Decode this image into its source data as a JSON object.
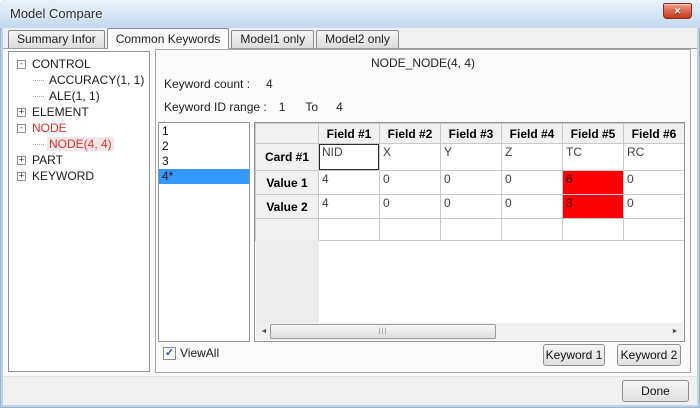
{
  "window": {
    "title": "Model Compare",
    "close_glyph": "✕"
  },
  "tabs": [
    {
      "label": "Summary Infor",
      "active": false
    },
    {
      "label": "Common Keywords",
      "active": true
    },
    {
      "label": "Model1 only",
      "active": false
    },
    {
      "label": "Model2 only",
      "active": false
    }
  ],
  "tree": {
    "items": [
      {
        "label": "CONTROL",
        "level": 0,
        "expander": "minus",
        "red": false,
        "selected": false
      },
      {
        "label": "ACCURACY(1, 1)",
        "level": 1,
        "expander": "none",
        "red": false,
        "selected": false
      },
      {
        "label": "ALE(1, 1)",
        "level": 1,
        "expander": "none",
        "red": false,
        "selected": false
      },
      {
        "label": "ELEMENT",
        "level": 0,
        "expander": "plus",
        "red": false,
        "selected": false
      },
      {
        "label": "NODE",
        "level": 0,
        "expander": "minus",
        "red": true,
        "selected": false
      },
      {
        "label": "NODE(4, 4)",
        "level": 1,
        "expander": "none",
        "red": true,
        "selected": true
      },
      {
        "label": "PART",
        "level": 0,
        "expander": "plus",
        "red": false,
        "selected": false
      },
      {
        "label": "KEYWORD",
        "level": 0,
        "expander": "plus",
        "red": false,
        "selected": false
      }
    ]
  },
  "panel": {
    "title": "NODE_NODE(4, 4)",
    "keyword_count_label": "Keyword count :",
    "keyword_count": "4",
    "id_range_label": "Keyword ID range :",
    "id_range_from": "1",
    "id_range_to_label": "To",
    "id_range_to": "4",
    "list_items": [
      "1",
      "2",
      "3",
      "4*"
    ],
    "selected_list_index": 3,
    "table": {
      "corner": "",
      "columns": [
        "Field #1",
        "Field #2",
        "Field #3",
        "Field #4",
        "Field #5",
        "Field #6"
      ],
      "rows": [
        {
          "header": "Card #1",
          "cells": [
            {
              "text": "NID",
              "focus": true
            },
            {
              "text": "X"
            },
            {
              "text": "Y"
            },
            {
              "text": "Z"
            },
            {
              "text": "TC"
            },
            {
              "text": "RC"
            }
          ]
        },
        {
          "header": "Value 1",
          "cells": [
            {
              "text": "4"
            },
            {
              "text": "0"
            },
            {
              "text": "0"
            },
            {
              "text": "0"
            },
            {
              "text": "6",
              "diff": true
            },
            {
              "text": "0"
            }
          ]
        },
        {
          "header": "Value 2",
          "cells": [
            {
              "text": "4"
            },
            {
              "text": "0"
            },
            {
              "text": "0"
            },
            {
              "text": "0"
            },
            {
              "text": "3",
              "diff": true
            },
            {
              "text": "0"
            }
          ]
        },
        {
          "header": "",
          "cells": [
            {
              "text": ""
            },
            {
              "text": ""
            },
            {
              "text": ""
            },
            {
              "text": ""
            },
            {
              "text": ""
            },
            {
              "text": ""
            }
          ]
        }
      ]
    },
    "viewall_label": "ViewAll",
    "viewall_checked": true,
    "check_glyph": "✓",
    "keyword1_label": "Keyword 1",
    "keyword2_label": "Keyword 2"
  },
  "scrollbar": {
    "left_glyph": "◄",
    "right_glyph": "►",
    "grip_glyph": "|||"
  },
  "footer": {
    "done_label": "Done"
  },
  "colors": {
    "diff_highlight": "#ff0000",
    "selection_blue": "#3399ff",
    "tree_alert": "#e12f2f",
    "titlebar_blue": "#d3e3f3"
  }
}
